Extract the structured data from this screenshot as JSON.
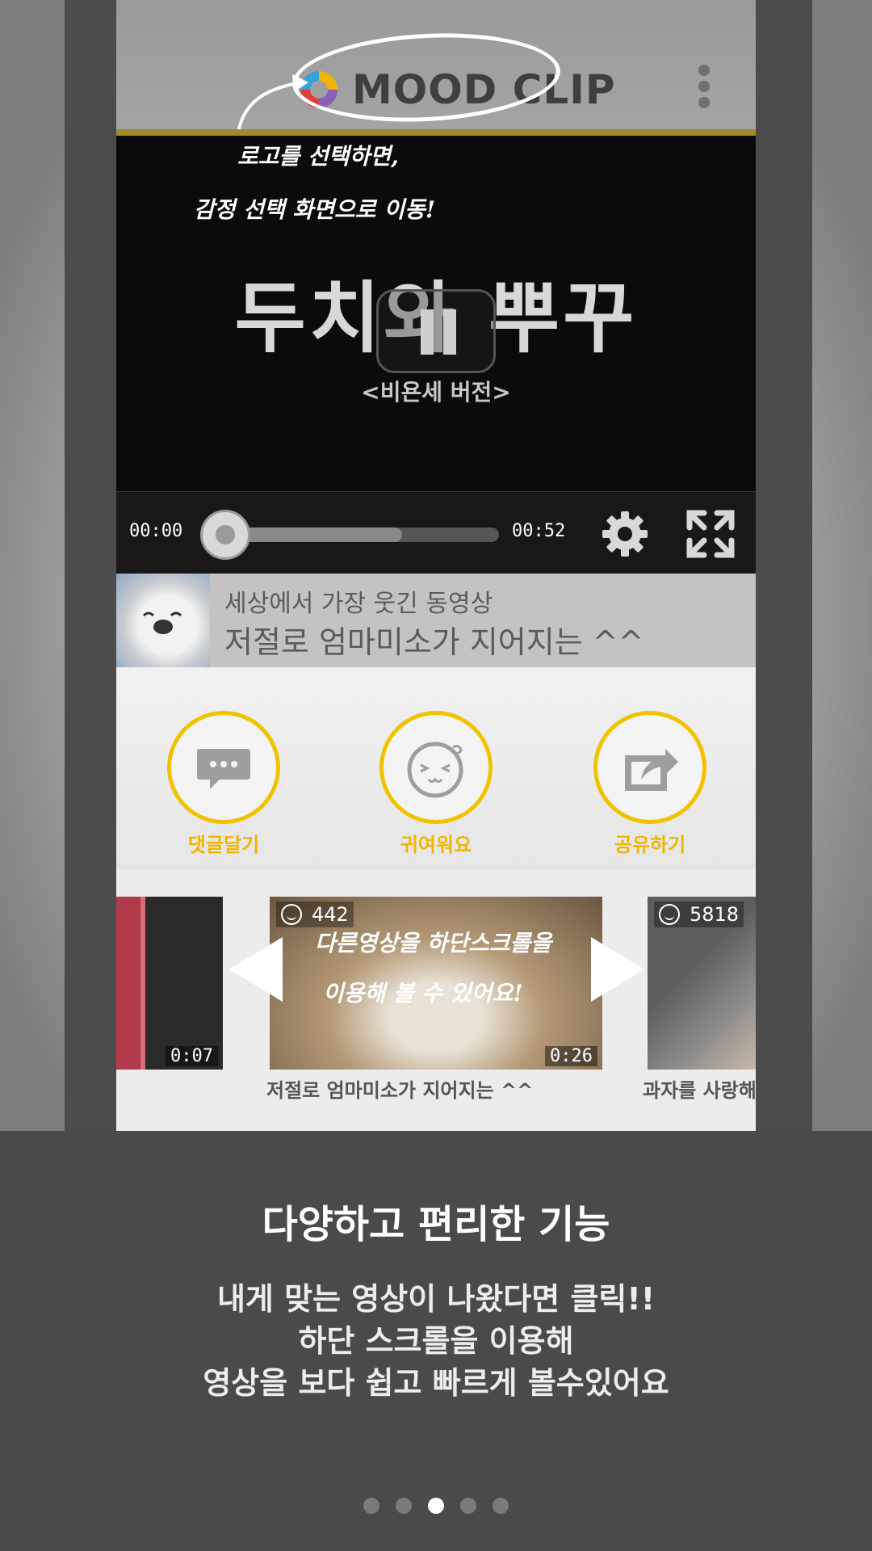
{
  "app": {
    "logo_text": "MOOD CLIP",
    "colors": {
      "accent": "#f1c200",
      "appbar": "#a0a0a0",
      "stripe": "#a08d2a"
    }
  },
  "annotations": {
    "logo_line1": "로고를 선택하면,",
    "logo_line2": "감정 선택 화면으로 이동!",
    "scroll_line1": "다른영상을 하단스크롤을",
    "scroll_line2": "이용해  볼 수 있어요!"
  },
  "video": {
    "title_text": "두치와 뿌꾸",
    "subtitle_text": "<비욘세 버전>",
    "state": "playing",
    "current_time": "00:00",
    "duration": "00:52",
    "buffered_fraction": 0.65,
    "icons": [
      "pause-icon",
      "gear-icon",
      "fullscreen-icon"
    ]
  },
  "info": {
    "line1": "세상에서 가장 웃긴 동영상",
    "line2": "저절로 엄마미소가 지어지는 ^^"
  },
  "actions": [
    {
      "label": "댓글달기",
      "icon": "comment-icon"
    },
    {
      "label": "귀여워요",
      "icon": "cute-face-icon"
    },
    {
      "label": "공유하기",
      "icon": "share-icon"
    }
  ],
  "thumbnails": [
    {
      "views": "",
      "duration": "0:07",
      "caption": ""
    },
    {
      "views": "442",
      "duration": "0:26",
      "caption": "저절로 엄마미소가 지어지는 ^^"
    },
    {
      "views": "5818",
      "duration": "",
      "caption": "과자를 사랑해"
    }
  ],
  "onboarding": {
    "heading": "다양하고 편리한 기능",
    "desc_line1": "내게 맞는 영상이 나왔다면 클릭!!",
    "desc_line2": "하단 스크롤을 이용해",
    "desc_line3": "영상을 보다 쉽고 빠르게 볼수있어요",
    "page_count": 5,
    "active_page": 3
  }
}
